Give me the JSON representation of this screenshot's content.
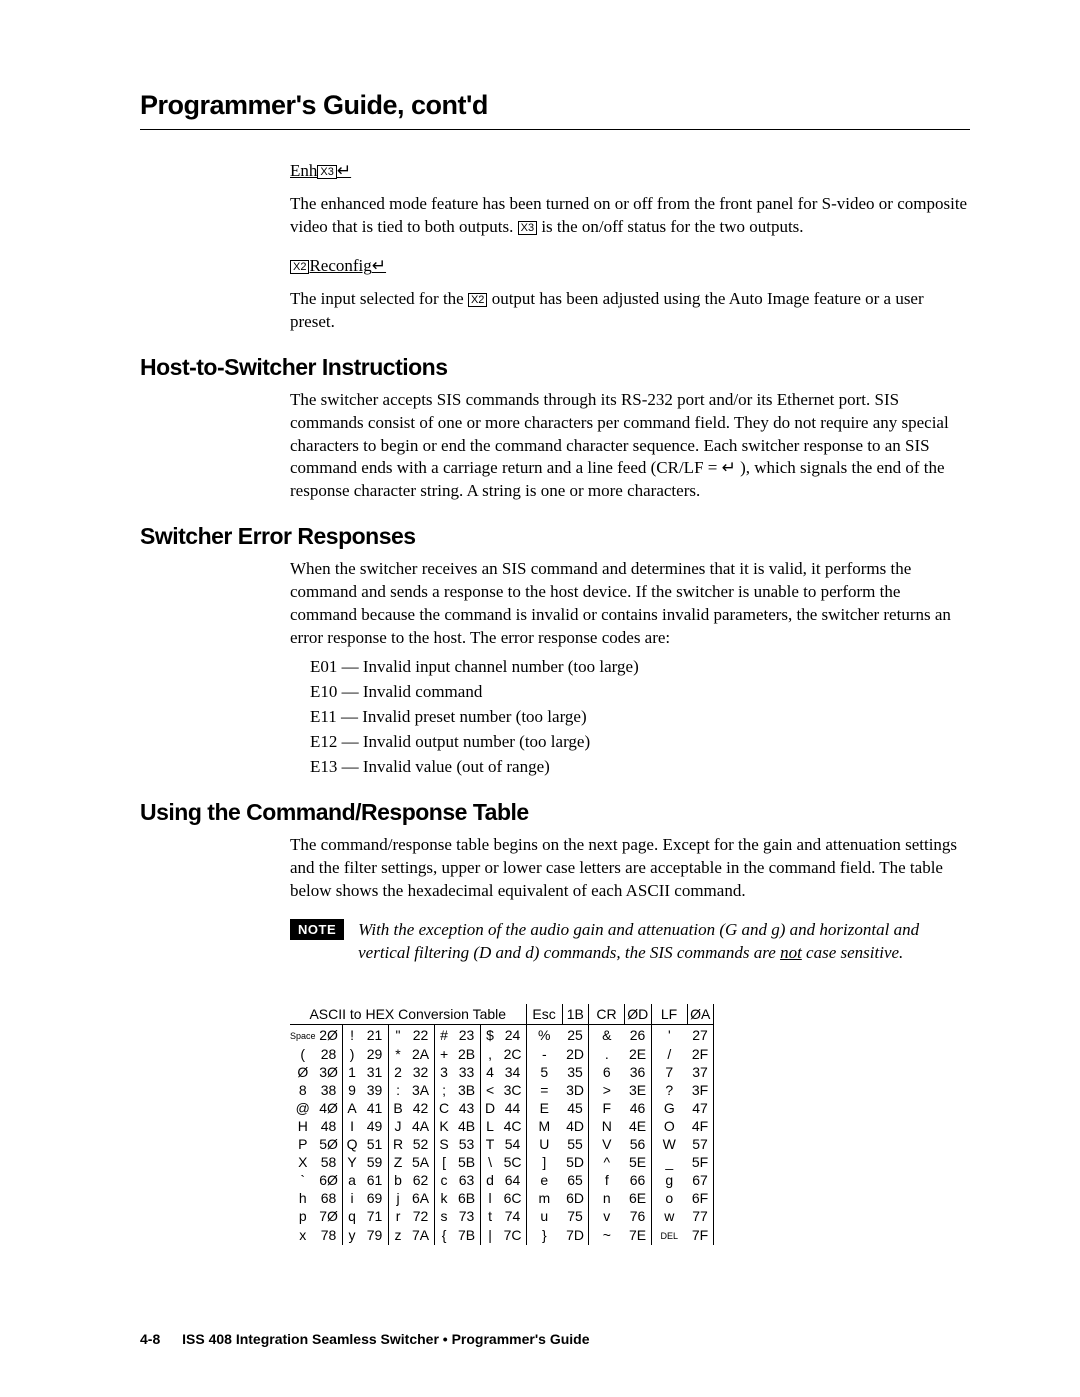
{
  "header": {
    "title": "Programmer's Guide, cont'd"
  },
  "enh": {
    "label_prefix": "Enh",
    "x3_badge": "X3",
    "return": "↵",
    "para": "The enhanced mode feature has been turned on or off from the front panel for S-video or composite video that is tied to both outputs.  ",
    "para_tail": " is the on/off status for the two outputs."
  },
  "reconfig": {
    "x2_badge": "X2",
    "label_mid": "Reconfig",
    "return": "↵",
    "para_a": "The input selected for the ",
    "para_b": " output has been adjusted using the Auto Image feature or a user preset."
  },
  "host": {
    "heading": "Host-to-Switcher Instructions",
    "para": "The switcher accepts SIS commands through its RS-232 port and/or its Ethernet port.  SIS commands consist of one or more characters per command field.  They do not require any special characters to begin or end the command character sequence.  Each switcher response to an SIS command ends with a carriage return and a line feed (CR/LF = ↵ ), which signals the end of the response character string.  A string is one or more characters."
  },
  "errors": {
    "heading": "Switcher Error Responses",
    "para": "When the switcher receives an SIS command and determines that it is valid, it performs the command and sends a response to the host device.  If the switcher is unable to perform the command because the command is invalid or contains invalid parameters, the switcher returns an error response to the host.  The error response codes are:",
    "list": [
      "E01 — Invalid input channel number (too large)",
      "E10 — Invalid command",
      "E11 — Invalid preset number (too large)",
      "E12 — Invalid output number (too large)",
      "E13 — Invalid value (out of range)"
    ]
  },
  "usage": {
    "heading": "Using the Command/Response Table",
    "para": "The command/response table begins on the next page.  Except for the gain and attenuation settings and the filter settings, upper or lower case letters are acceptable in the command field.  The table below shows the hexadecimal equivalent of each ASCII command.",
    "note_label": "NOTE",
    "note_text_a": "With the exception of the audio gain and attenuation (G and g) and horizontal and vertical filtering (D and d) commands, the SIS commands are ",
    "note_not": "not",
    "note_text_b": " case sensitive."
  },
  "ascii": {
    "title": "ASCII to HEX  Conversion Table",
    "header_pairs": [
      {
        "k": "Esc",
        "v": "1B"
      },
      {
        "k": "CR",
        "v": "ØD"
      },
      {
        "k": "LF",
        "v": "ØA"
      }
    ],
    "rows": [
      [
        {
          "c": "Space",
          "h": "2Ø"
        },
        {
          "c": "!",
          "h": "21"
        },
        {
          "c": "\"",
          "h": "22"
        },
        {
          "c": "#",
          "h": "23"
        },
        {
          "c": "$",
          "h": "24"
        },
        {
          "c": "%",
          "h": "25"
        },
        {
          "c": "&",
          "h": "26"
        },
        {
          "c": "'",
          "h": "27"
        }
      ],
      [
        {
          "c": "(",
          "h": "28"
        },
        {
          "c": ")",
          "h": "29"
        },
        {
          "c": "*",
          "h": "2A"
        },
        {
          "c": "+",
          "h": "2B"
        },
        {
          "c": ",",
          "h": "2C"
        },
        {
          "c": "-",
          "h": "2D"
        },
        {
          "c": ".",
          "h": "2E"
        },
        {
          "c": "/",
          "h": "2F"
        }
      ],
      [
        {
          "c": "Ø",
          "h": "3Ø"
        },
        {
          "c": "1",
          "h": "31"
        },
        {
          "c": "2",
          "h": "32"
        },
        {
          "c": "3",
          "h": "33"
        },
        {
          "c": "4",
          "h": "34"
        },
        {
          "c": "5",
          "h": "35"
        },
        {
          "c": "6",
          "h": "36"
        },
        {
          "c": "7",
          "h": "37"
        }
      ],
      [
        {
          "c": "8",
          "h": "38"
        },
        {
          "c": "9",
          "h": "39"
        },
        {
          "c": ":",
          "h": "3A"
        },
        {
          "c": ";",
          "h": "3B"
        },
        {
          "c": "<",
          "h": "3C"
        },
        {
          "c": "=",
          "h": "3D"
        },
        {
          "c": ">",
          "h": "3E"
        },
        {
          "c": "?",
          "h": "3F"
        }
      ],
      [
        {
          "c": "@",
          "h": "4Ø"
        },
        {
          "c": "A",
          "h": "41"
        },
        {
          "c": "B",
          "h": "42"
        },
        {
          "c": "C",
          "h": "43"
        },
        {
          "c": "D",
          "h": "44"
        },
        {
          "c": "E",
          "h": "45"
        },
        {
          "c": "F",
          "h": "46"
        },
        {
          "c": "G",
          "h": "47"
        }
      ],
      [
        {
          "c": "H",
          "h": "48"
        },
        {
          "c": "I",
          "h": "49"
        },
        {
          "c": "J",
          "h": "4A"
        },
        {
          "c": "K",
          "h": "4B"
        },
        {
          "c": "L",
          "h": "4C"
        },
        {
          "c": "M",
          "h": "4D"
        },
        {
          "c": "N",
          "h": "4E"
        },
        {
          "c": "O",
          "h": "4F"
        }
      ],
      [
        {
          "c": "P",
          "h": "5Ø"
        },
        {
          "c": "Q",
          "h": "51"
        },
        {
          "c": "R",
          "h": "52"
        },
        {
          "c": "S",
          "h": "53"
        },
        {
          "c": "T",
          "h": "54"
        },
        {
          "c": "U",
          "h": "55"
        },
        {
          "c": "V",
          "h": "56"
        },
        {
          "c": "W",
          "h": "57"
        }
      ],
      [
        {
          "c": "X",
          "h": "58"
        },
        {
          "c": "Y",
          "h": "59"
        },
        {
          "c": "Z",
          "h": "5A"
        },
        {
          "c": "[",
          "h": "5B"
        },
        {
          "c": "\\",
          "h": "5C"
        },
        {
          "c": "]",
          "h": "5D"
        },
        {
          "c": "^",
          "h": "5E"
        },
        {
          "c": "_",
          "h": "5F"
        }
      ],
      [
        {
          "c": "`",
          "h": "6Ø"
        },
        {
          "c": "a",
          "h": "61"
        },
        {
          "c": "b",
          "h": "62"
        },
        {
          "c": "c",
          "h": "63"
        },
        {
          "c": "d",
          "h": "64"
        },
        {
          "c": "e",
          "h": "65"
        },
        {
          "c": "f",
          "h": "66"
        },
        {
          "c": "g",
          "h": "67"
        }
      ],
      [
        {
          "c": "h",
          "h": "68"
        },
        {
          "c": "i",
          "h": "69"
        },
        {
          "c": "j",
          "h": "6A"
        },
        {
          "c": "k",
          "h": "6B"
        },
        {
          "c": "l",
          "h": "6C"
        },
        {
          "c": "m",
          "h": "6D"
        },
        {
          "c": "n",
          "h": "6E"
        },
        {
          "c": "o",
          "h": "6F"
        }
      ],
      [
        {
          "c": "p",
          "h": "7Ø"
        },
        {
          "c": "q",
          "h": "71"
        },
        {
          "c": "r",
          "h": "72"
        },
        {
          "c": "s",
          "h": "73"
        },
        {
          "c": "t",
          "h": "74"
        },
        {
          "c": "u",
          "h": "75"
        },
        {
          "c": "v",
          "h": "76"
        },
        {
          "c": "w",
          "h": "77"
        }
      ],
      [
        {
          "c": "x",
          "h": "78"
        },
        {
          "c": "y",
          "h": "79"
        },
        {
          "c": "z",
          "h": "7A"
        },
        {
          "c": "{",
          "h": "7B"
        },
        {
          "c": "|",
          "h": "7C"
        },
        {
          "c": "}",
          "h": "7D"
        },
        {
          "c": "~",
          "h": "7E"
        },
        {
          "c": "DEL",
          "h": "7F"
        }
      ]
    ]
  },
  "footer": {
    "page": "4-8",
    "text": "ISS 408 Integration Seamless Switcher • Programmer's Guide"
  }
}
